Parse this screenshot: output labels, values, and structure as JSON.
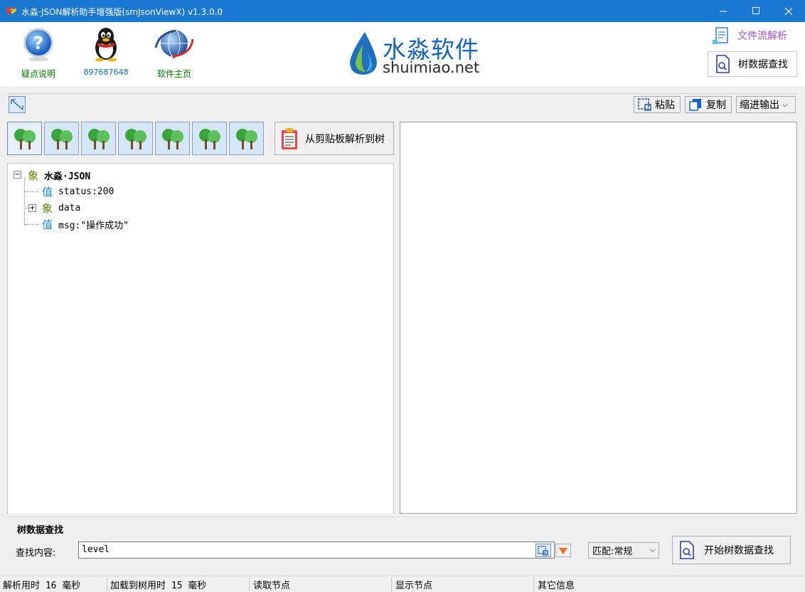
{
  "window": {
    "title": "水淼·JSON解析助手增强版(smJsonViewX) v1.3.0.0",
    "icon": "app-hearts-icon"
  },
  "header": {
    "buttons": [
      {
        "label": "疑点说明",
        "icon": "help-question-icon"
      },
      {
        "label": "897687648",
        "icon": "qq-penguin-icon"
      },
      {
        "label": "软件主页",
        "icon": "globe-icon"
      }
    ],
    "logo": {
      "cn": "水淼软件",
      "en": "shuimiao.net"
    },
    "right_buttons": [
      {
        "label": "文件流解析",
        "icon": "file-stream-icon"
      },
      {
        "label": "树数据查找",
        "icon": "doc-search-icon"
      }
    ]
  },
  "toolbar": {
    "paste_label": "粘贴",
    "copy_label": "复制",
    "output_mode": "缩进输出"
  },
  "parse_button_label": "从剪贴板解析到树",
  "tree": {
    "root": {
      "kind": "象",
      "label": "水淼·JSON"
    },
    "children": [
      {
        "kind": "值",
        "label": "status:200",
        "expandable": false
      },
      {
        "kind": "象",
        "label": "data",
        "expandable": true
      },
      {
        "kind": "值",
        "label": "msg:\"操作成功\"",
        "expandable": false
      }
    ]
  },
  "search": {
    "group_title": "树数据查找",
    "field_label": "查找内容:",
    "value": "level",
    "match": "匹配:常规",
    "start_label": "开始树数据查找"
  },
  "status": {
    "parse_time": "解析用时 16 毫秒",
    "load_time": "加载到树用时 15 毫秒",
    "read_node": "读取节点",
    "show_node": "显示节点",
    "other": "其它信息"
  },
  "colors": {
    "titlebar": "#1979d0",
    "brand_blue": "#1565b8",
    "link_green": "#008000"
  }
}
